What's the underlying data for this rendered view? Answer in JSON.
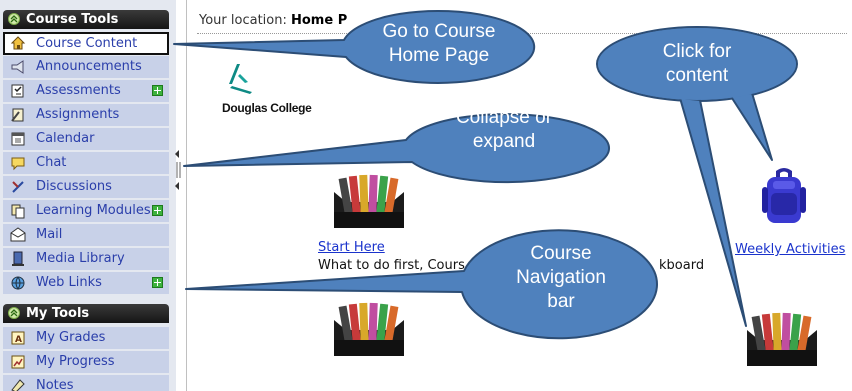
{
  "nav": {
    "course_tools": {
      "title": "Course Tools",
      "items": [
        {
          "label": "Course Content",
          "icon": "home-icon",
          "active": true
        },
        {
          "label": "Announcements",
          "icon": "megaphone-icon"
        },
        {
          "label": "Assessments",
          "icon": "assessment-icon",
          "add": true
        },
        {
          "label": "Assignments",
          "icon": "assignment-icon"
        },
        {
          "label": "Calendar",
          "icon": "calendar-icon"
        },
        {
          "label": "Chat",
          "icon": "chat-icon"
        },
        {
          "label": "Discussions",
          "icon": "discussion-icon"
        },
        {
          "label": "Learning Modules",
          "icon": "module-icon",
          "add": true
        },
        {
          "label": "Mail",
          "icon": "mail-icon"
        },
        {
          "label": "Media Library",
          "icon": "media-icon"
        },
        {
          "label": "Web Links",
          "icon": "globe-icon",
          "add": true
        }
      ]
    },
    "my_tools": {
      "title": "My Tools",
      "items": [
        {
          "label": "My Grades",
          "icon": "grades-icon"
        },
        {
          "label": "My Progress",
          "icon": "progress-icon"
        },
        {
          "label": "Notes",
          "icon": "notes-icon"
        }
      ]
    }
  },
  "content": {
    "location_prefix": "Your location:",
    "location_value": "Home P",
    "logo_name": "Douglas College",
    "start_here": {
      "link": "Start Here",
      "desc_left": "What to do first, Cours",
      "desc_right": "kboard"
    },
    "weekly": {
      "link": "Weekly Activities"
    }
  },
  "callouts": {
    "home": "Go to Course\nHome Page",
    "collapse": "Collapse or\nexpand",
    "navbar": "Course\nNavigation\nbar",
    "content": "Click for\ncontent"
  },
  "colors": {
    "callout_fill": "#4f81bd",
    "callout_stroke": "#2c4d75",
    "nav_item_bg": "#c8d1e8",
    "nav_link": "#2a3eaa",
    "content_link": "#1a33cc"
  }
}
